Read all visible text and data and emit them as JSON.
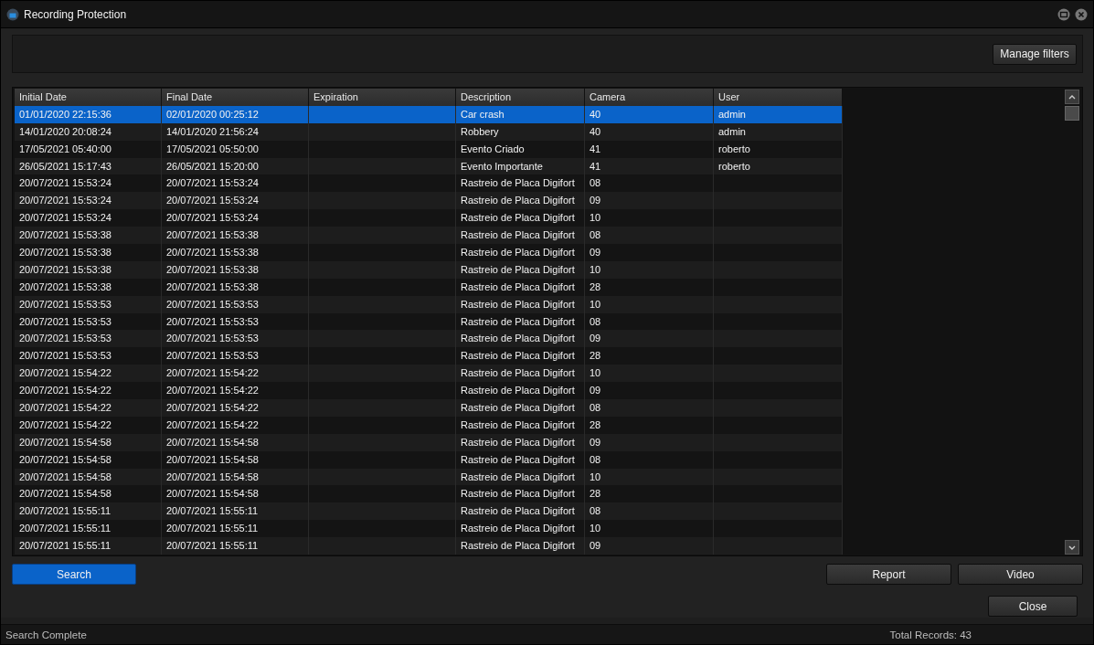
{
  "window": {
    "title": "Recording Protection"
  },
  "filters": {
    "manage_button": "Manage filters"
  },
  "table": {
    "columns": [
      "Initial Date",
      "Final Date",
      "Expiration",
      "Description",
      "Camera",
      "User"
    ],
    "rows": [
      {
        "cells": [
          "01/01/2020 22:15:36",
          "02/01/2020 00:25:12",
          "",
          "Car crash",
          "40",
          "admin"
        ],
        "selected": true
      },
      {
        "cells": [
          "14/01/2020 20:08:24",
          "14/01/2020 21:56:24",
          "",
          "Robbery",
          "40",
          "admin"
        ],
        "selected": false
      },
      {
        "cells": [
          "17/05/2021 05:40:00",
          "17/05/2021 05:50:00",
          "",
          "Evento Criado",
          "41",
          "roberto"
        ],
        "selected": false
      },
      {
        "cells": [
          "26/05/2021 15:17:43",
          "26/05/2021 15:20:00",
          "",
          "Evento Importante",
          "41",
          "roberto"
        ],
        "selected": false
      },
      {
        "cells": [
          "20/07/2021 15:53:24",
          "20/07/2021 15:53:24",
          "",
          "Rastreio de Placa Digifort",
          "08",
          ""
        ],
        "selected": false
      },
      {
        "cells": [
          "20/07/2021 15:53:24",
          "20/07/2021 15:53:24",
          "",
          "Rastreio de Placa Digifort",
          "09",
          ""
        ],
        "selected": false
      },
      {
        "cells": [
          "20/07/2021 15:53:24",
          "20/07/2021 15:53:24",
          "",
          "Rastreio de Placa Digifort",
          "10",
          ""
        ],
        "selected": false
      },
      {
        "cells": [
          "20/07/2021 15:53:38",
          "20/07/2021 15:53:38",
          "",
          "Rastreio de Placa Digifort",
          "08",
          ""
        ],
        "selected": false
      },
      {
        "cells": [
          "20/07/2021 15:53:38",
          "20/07/2021 15:53:38",
          "",
          "Rastreio de Placa Digifort",
          "09",
          ""
        ],
        "selected": false
      },
      {
        "cells": [
          "20/07/2021 15:53:38",
          "20/07/2021 15:53:38",
          "",
          "Rastreio de Placa Digifort",
          "10",
          ""
        ],
        "selected": false
      },
      {
        "cells": [
          "20/07/2021 15:53:38",
          "20/07/2021 15:53:38",
          "",
          "Rastreio de Placa Digifort",
          "28",
          ""
        ],
        "selected": false
      },
      {
        "cells": [
          "20/07/2021 15:53:53",
          "20/07/2021 15:53:53",
          "",
          "Rastreio de Placa Digifort",
          "10",
          ""
        ],
        "selected": false
      },
      {
        "cells": [
          "20/07/2021 15:53:53",
          "20/07/2021 15:53:53",
          "",
          "Rastreio de Placa Digifort",
          "08",
          ""
        ],
        "selected": false
      },
      {
        "cells": [
          "20/07/2021 15:53:53",
          "20/07/2021 15:53:53",
          "",
          "Rastreio de Placa Digifort",
          "09",
          ""
        ],
        "selected": false
      },
      {
        "cells": [
          "20/07/2021 15:53:53",
          "20/07/2021 15:53:53",
          "",
          "Rastreio de Placa Digifort",
          "28",
          ""
        ],
        "selected": false
      },
      {
        "cells": [
          "20/07/2021 15:54:22",
          "20/07/2021 15:54:22",
          "",
          "Rastreio de Placa Digifort",
          "10",
          ""
        ],
        "selected": false
      },
      {
        "cells": [
          "20/07/2021 15:54:22",
          "20/07/2021 15:54:22",
          "",
          "Rastreio de Placa Digifort",
          "09",
          ""
        ],
        "selected": false
      },
      {
        "cells": [
          "20/07/2021 15:54:22",
          "20/07/2021 15:54:22",
          "",
          "Rastreio de Placa Digifort",
          "08",
          ""
        ],
        "selected": false
      },
      {
        "cells": [
          "20/07/2021 15:54:22",
          "20/07/2021 15:54:22",
          "",
          "Rastreio de Placa Digifort",
          "28",
          ""
        ],
        "selected": false
      },
      {
        "cells": [
          "20/07/2021 15:54:58",
          "20/07/2021 15:54:58",
          "",
          "Rastreio de Placa Digifort",
          "09",
          ""
        ],
        "selected": false
      },
      {
        "cells": [
          "20/07/2021 15:54:58",
          "20/07/2021 15:54:58",
          "",
          "Rastreio de Placa Digifort",
          "08",
          ""
        ],
        "selected": false
      },
      {
        "cells": [
          "20/07/2021 15:54:58",
          "20/07/2021 15:54:58",
          "",
          "Rastreio de Placa Digifort",
          "10",
          ""
        ],
        "selected": false
      },
      {
        "cells": [
          "20/07/2021 15:54:58",
          "20/07/2021 15:54:58",
          "",
          "Rastreio de Placa Digifort",
          "28",
          ""
        ],
        "selected": false
      },
      {
        "cells": [
          "20/07/2021 15:55:11",
          "20/07/2021 15:55:11",
          "",
          "Rastreio de Placa Digifort",
          "08",
          ""
        ],
        "selected": false
      },
      {
        "cells": [
          "20/07/2021 15:55:11",
          "20/07/2021 15:55:11",
          "",
          "Rastreio de Placa Digifort",
          "10",
          ""
        ],
        "selected": false
      },
      {
        "cells": [
          "20/07/2021 15:55:11",
          "20/07/2021 15:55:11",
          "",
          "Rastreio de Placa Digifort",
          "09",
          ""
        ],
        "selected": false
      }
    ]
  },
  "actions": {
    "search": "Search",
    "report": "Report",
    "video": "Video",
    "close": "Close"
  },
  "status_bar": {
    "message": "Search Complete",
    "total": "Total Records: 43"
  }
}
